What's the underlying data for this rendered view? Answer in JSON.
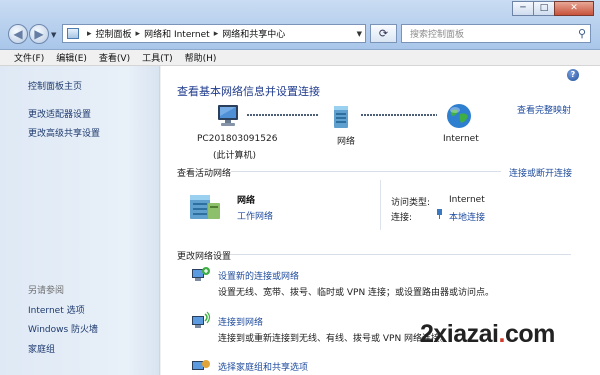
{
  "window": {
    "buttons": {
      "minimize": "─",
      "maximize": "□",
      "close": "✕"
    }
  },
  "address_bar": {
    "breadcrumbs": [
      "控制面板",
      "网络和 Internet",
      "网络和共享中心"
    ],
    "search_placeholder": "搜索控制面板"
  },
  "menu": [
    "文件(F)",
    "编辑(E)",
    "查看(V)",
    "工具(T)",
    "帮助(H)"
  ],
  "sidebar": {
    "home": "控制面板主页",
    "links": [
      "更改适配器设置",
      "更改高级共享设置"
    ],
    "see_also_title": "另请参阅",
    "see_also": [
      "Internet 选项",
      "Windows 防火墙",
      "家庭组"
    ]
  },
  "main": {
    "title": "查看基本网络信息并设置连接",
    "view_full_map": "查看完整映射",
    "nodes": {
      "computer_name": "PC201803091526",
      "computer_sub": "(此计算机)",
      "network": "网络",
      "internet": "Internet"
    },
    "active_networks": {
      "label": "查看活动网络",
      "connect_link": "连接或断开连接",
      "name": "网络",
      "type": "工作网络",
      "access_type_label": "访问类型:",
      "access_type_value": "Internet",
      "connection_label": "连接:",
      "connection_value": "本地连接"
    },
    "change_settings": {
      "label": "更改网络设置",
      "tasks": [
        {
          "title": "设置新的连接或网络",
          "desc": "设置无线、宽带、拨号、临时或 VPN 连接；或设置路由器或访问点。"
        },
        {
          "title": "连接到网络",
          "desc": "连接到或重新连接到无线、有线、拨号或 VPN 网络连接。"
        },
        {
          "title": "选择家庭组和共享选项",
          "desc": ""
        }
      ]
    }
  },
  "watermark": {
    "part1": "2xiazai",
    "dot": ".",
    "part2": "com"
  },
  "colors": {
    "link": "#1f4c9e",
    "title": "#1e3a8c",
    "sidebar": "#dfe9f5"
  }
}
